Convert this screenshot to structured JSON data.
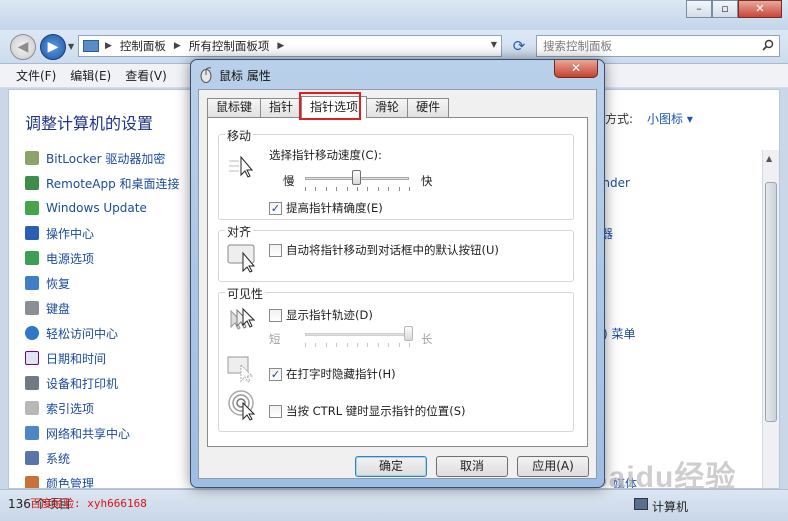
{
  "explorer": {
    "address": [
      "控制面板",
      "所有控制面板项"
    ],
    "search_placeholder": "搜索控制面板",
    "menu": [
      "文件(F)",
      "编辑(E)",
      "查看(V)"
    ],
    "heading": "调整计算机的设置",
    "view_by_label": "方式:",
    "view_by_value": "小图标",
    "items": [
      "BitLocker 驱动器加密",
      "RemoteApp 和桌面连接",
      "Windows Update",
      "操作中心",
      "电源选项",
      "恢复",
      "键盘",
      "轻松访问中心",
      "日期和时间",
      "设备和打印机",
      "索引选项",
      "网络和共享中心",
      "系统",
      "颜色管理"
    ],
    "right_fragments": [
      "ender",
      "器",
      "(l) 菜单",
      "媒体"
    ],
    "status_count": "136 个项目",
    "status_location": "计算机"
  },
  "watermark": {
    "experience": "百度经验: xyh666168",
    "logo": "Baidu经验"
  },
  "dialog": {
    "title": "鼠标 属性",
    "tabs": [
      "鼠标键",
      "指针",
      "指针选项",
      "滑轮",
      "硬件"
    ],
    "active_tab": "指针选项",
    "motion": {
      "title": "移动",
      "speed_label": "选择指针移动速度(C):",
      "slow": "慢",
      "fast": "快",
      "speed_level": 0.5,
      "enhance_label": "提高指针精确度(E)",
      "enhance_checked": true
    },
    "snap": {
      "title": "对齐",
      "label": "自动将指针移动到对话框中的默认按钮(U)",
      "checked": false
    },
    "visibility": {
      "title": "可见性",
      "trails_label": "显示指针轨迹(D)",
      "trails_checked": false,
      "short": "短",
      "long": "长",
      "trails_level": 1.0,
      "hide_label": "在打字时隐藏指针(H)",
      "hide_checked": true,
      "ctrl_label": "当按 CTRL 键时显示指针的位置(S)",
      "ctrl_checked": false
    },
    "buttons": {
      "ok": "确定",
      "cancel": "取消",
      "apply": "应用(A)"
    },
    "check_mark": "✓"
  }
}
